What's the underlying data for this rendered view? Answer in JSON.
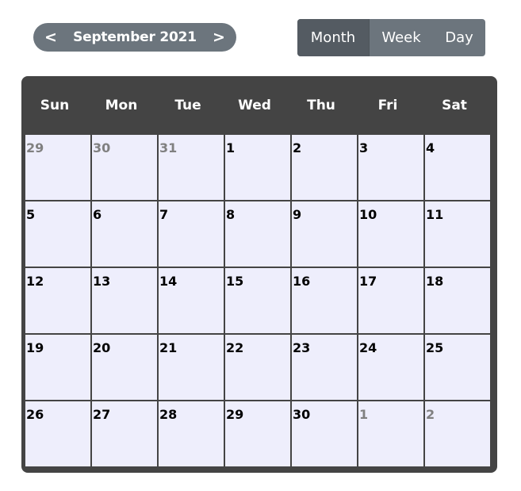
{
  "nav": {
    "prev_label": "<",
    "next_label": ">",
    "title": "September 2021"
  },
  "views": [
    {
      "label": "Month",
      "active": true
    },
    {
      "label": "Week",
      "active": false
    },
    {
      "label": "Day",
      "active": false
    }
  ],
  "weekdays": [
    "Sun",
    "Mon",
    "Tue",
    "Wed",
    "Thu",
    "Fri",
    "Sat"
  ],
  "weeks": [
    [
      {
        "d": "29",
        "other": true
      },
      {
        "d": "30",
        "other": true
      },
      {
        "d": "31",
        "other": true
      },
      {
        "d": "1",
        "other": false
      },
      {
        "d": "2",
        "other": false
      },
      {
        "d": "3",
        "other": false
      },
      {
        "d": "4",
        "other": false
      }
    ],
    [
      {
        "d": "5",
        "other": false
      },
      {
        "d": "6",
        "other": false
      },
      {
        "d": "7",
        "other": false
      },
      {
        "d": "8",
        "other": false
      },
      {
        "d": "9",
        "other": false
      },
      {
        "d": "10",
        "other": false
      },
      {
        "d": "11",
        "other": false
      }
    ],
    [
      {
        "d": "12",
        "other": false
      },
      {
        "d": "13",
        "other": false
      },
      {
        "d": "14",
        "other": false
      },
      {
        "d": "15",
        "other": false
      },
      {
        "d": "16",
        "other": false
      },
      {
        "d": "17",
        "other": false
      },
      {
        "d": "18",
        "other": false
      }
    ],
    [
      {
        "d": "19",
        "other": false
      },
      {
        "d": "20",
        "other": false
      },
      {
        "d": "21",
        "other": false
      },
      {
        "d": "22",
        "other": false
      },
      {
        "d": "23",
        "other": false
      },
      {
        "d": "24",
        "other": false
      },
      {
        "d": "25",
        "other": false
      }
    ],
    [
      {
        "d": "26",
        "other": false
      },
      {
        "d": "27",
        "other": false
      },
      {
        "d": "28",
        "other": false
      },
      {
        "d": "29",
        "other": false
      },
      {
        "d": "30",
        "other": false
      },
      {
        "d": "1",
        "other": true
      },
      {
        "d": "2",
        "other": true
      }
    ]
  ],
  "colors": {
    "nav_bg": "#6c757d",
    "active_view_bg": "#545b62",
    "calendar_bg": "#444444",
    "cell_bg": "#eeeefc",
    "muted_day": "#808080"
  }
}
